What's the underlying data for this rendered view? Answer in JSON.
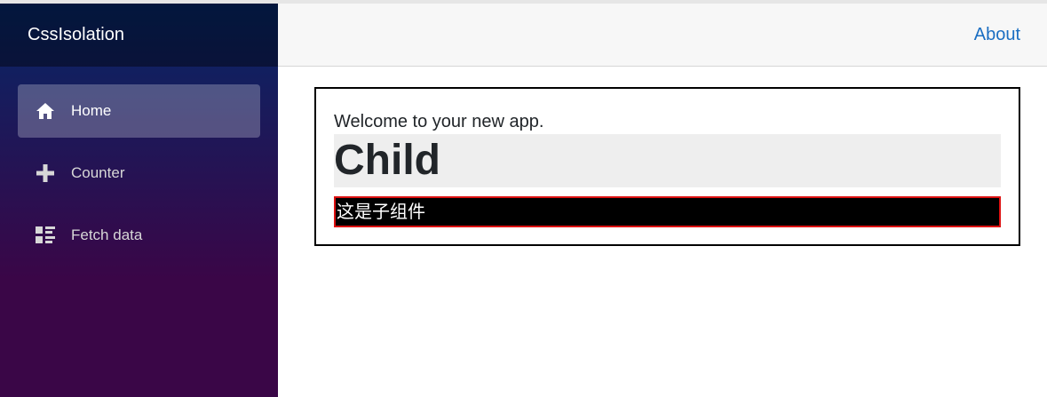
{
  "app": {
    "brand": "CssIsolation"
  },
  "nav": {
    "items": [
      {
        "label": "Home",
        "icon": "home-icon",
        "active": true
      },
      {
        "label": "Counter",
        "icon": "plus-icon",
        "active": false
      },
      {
        "label": "Fetch data",
        "icon": "list-rich-icon",
        "active": false
      }
    ]
  },
  "top_row": {
    "about_label": "About"
  },
  "main": {
    "welcome_text": "Welcome to your new app.",
    "child_heading": "Child",
    "child_text": "这是子组件"
  },
  "colors": {
    "sidebar_gradient_top": "#052767",
    "sidebar_gradient_bottom": "#3a0647",
    "link": "#1b6ec2",
    "child_border": "#dd1111"
  }
}
